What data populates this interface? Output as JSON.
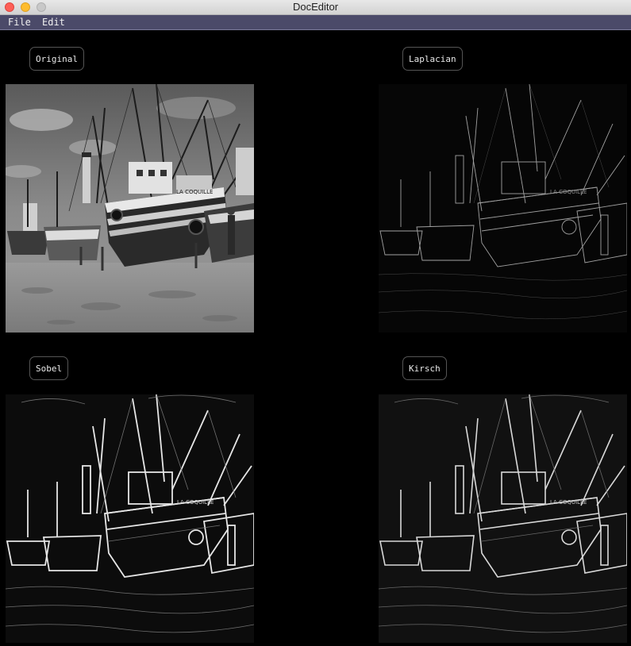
{
  "window": {
    "title": "DocEditor",
    "controls": [
      "close",
      "minimize",
      "maximize"
    ]
  },
  "menubar": {
    "items": [
      {
        "label": "File"
      },
      {
        "label": "Edit"
      }
    ]
  },
  "panels": [
    {
      "label": "Original",
      "image": "boat-photo-grayscale"
    },
    {
      "label": "Laplacian",
      "image": "boat-laplacian-edges"
    },
    {
      "label": "Sobel",
      "image": "boat-sobel-edges"
    },
    {
      "label": "Kirsch",
      "image": "boat-kirsch-edges"
    }
  ],
  "colors": {
    "background": "#000000",
    "menubar": "#4b4a69",
    "close": "#fe5f57",
    "minimize": "#febc2e",
    "maximize": "#c8c8c8"
  }
}
